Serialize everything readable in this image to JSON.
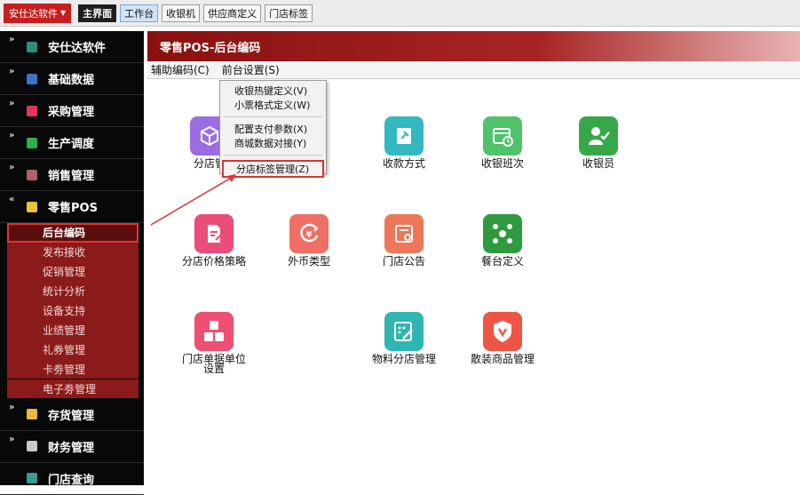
{
  "topbar": {
    "brand": "安仕达软件",
    "tabs": [
      "主界面",
      "工作台",
      "收银机",
      "供应商定义",
      "门店标签"
    ]
  },
  "sidebar": {
    "groups": [
      {
        "label": "安仕达软件",
        "color": "#2b8f7a",
        "chevron": "»"
      },
      {
        "label": "基础数据",
        "color": "#3b73c9",
        "chevron": "»"
      },
      {
        "label": "采购管理",
        "color": "#e0385c",
        "chevron": "»"
      },
      {
        "label": "生产调度",
        "color": "#2fae4e",
        "chevron": "»"
      },
      {
        "label": "销售管理",
        "color": "#b0606a",
        "chevron": "»"
      },
      {
        "label": "零售POS",
        "color": "#e9c23a",
        "chevron": "«"
      }
    ],
    "subitems": [
      "后台编码",
      "发布接收",
      "促销管理",
      "统计分析",
      "设备支持",
      "业绩管理",
      "礼券管理",
      "卡劵管理",
      "电子劵管理"
    ],
    "groups_after": [
      {
        "label": "存货管理",
        "color": "#e8b93a",
        "chevron": "»"
      },
      {
        "label": "财务管理",
        "color": "#c9c9c9",
        "chevron": "»"
      },
      {
        "label": "门店查询",
        "color": "#3a9c8f",
        "chevron": ""
      }
    ]
  },
  "main": {
    "title": "零售POS-后台编码",
    "menu": [
      "辅助编码(C)",
      "前台设置(S)"
    ]
  },
  "dropdown": {
    "group1": [
      "收银热键定义(V)",
      "小票格式定义(W)"
    ],
    "group2": [
      "配置支付参数(X)",
      "商城数据对接(Y)"
    ],
    "group3": [
      "分店标签管理(Z)"
    ]
  },
  "tiles": [
    {
      "label": "分店管",
      "icon": "cube-icon",
      "color": "#9b6de0"
    },
    {
      "label": "收款方式",
      "icon": "pin-icon",
      "color": "#33b8c0"
    },
    {
      "label": "收银班次",
      "icon": "calendar-icon",
      "color": "#4fc26a"
    },
    {
      "label": "收银员",
      "icon": "user-check-icon",
      "color": "#36a84a"
    },
    {
      "label": "分店价格策略",
      "icon": "document-edit-icon",
      "color": "#ea4d79"
    },
    {
      "label": "外币类型",
      "icon": "currency-icon",
      "color": "#ee7064"
    },
    {
      "label": "门店公告",
      "icon": "notice-icon",
      "color": "#ee7759"
    },
    {
      "label": "餐台定义",
      "icon": "network-icon",
      "color": "#2f9a3f"
    },
    {
      "label": "门店单据单位设置",
      "icon": "abc-icon",
      "color": "#ee4f73"
    },
    {
      "label": "物料分店管理",
      "icon": "grid-edit-icon",
      "color": "#2fb6b2"
    },
    {
      "label": "散装商品管理",
      "icon": "shield-v-icon",
      "color": "#ee5545"
    }
  ]
}
